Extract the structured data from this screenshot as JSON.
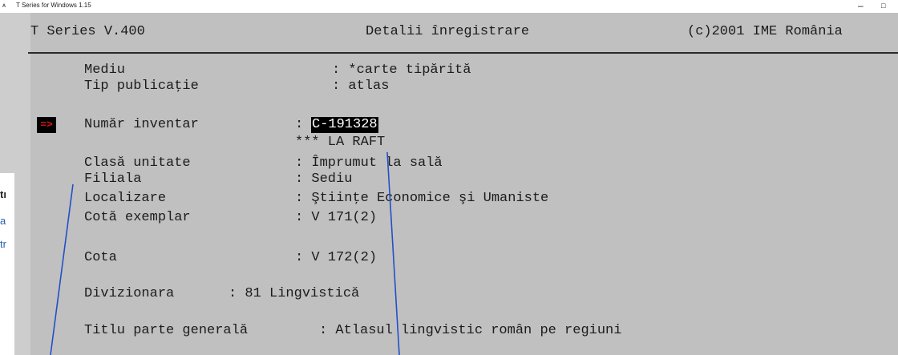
{
  "window": {
    "title": "T Series for Windows 1.15",
    "minimize": "–",
    "maximize": "□"
  },
  "background_fragments": [
    "tı",
    "a",
    "tr"
  ],
  "header": {
    "product": "T Series V.400",
    "screen": "Detalii înregistrare",
    "copyright": "(c)2001 IME România"
  },
  "marker": "=>",
  "fields": [
    {
      "label": "Mediu",
      "value": ": *carte tipărită"
    },
    {
      "label": "Tip publicaţie",
      "value": ": atlas"
    },
    {
      "label": "Număr inventar",
      "sep": ": ",
      "value": "C-191328"
    },
    {
      "label": "",
      "value": "*** LA RAFT"
    },
    {
      "label": "Clasă unitate",
      "value": ": Împrumut la sală"
    },
    {
      "label": "Filiala",
      "value": ": Sediu"
    },
    {
      "label": "Localizare",
      "value": ": Ştiinţe Economice şi Umaniste"
    },
    {
      "label": "Cotă exemplar",
      "value": ": V 171(2)"
    },
    {
      "label": "Cota",
      "value": ": V 172(2)"
    },
    {
      "label": "Divizionara",
      "value": ": 81 Lingvistică"
    },
    {
      "label": "Titlu parte generală",
      "value": ": Atlasul lingvistic român pe regiuni"
    }
  ]
}
